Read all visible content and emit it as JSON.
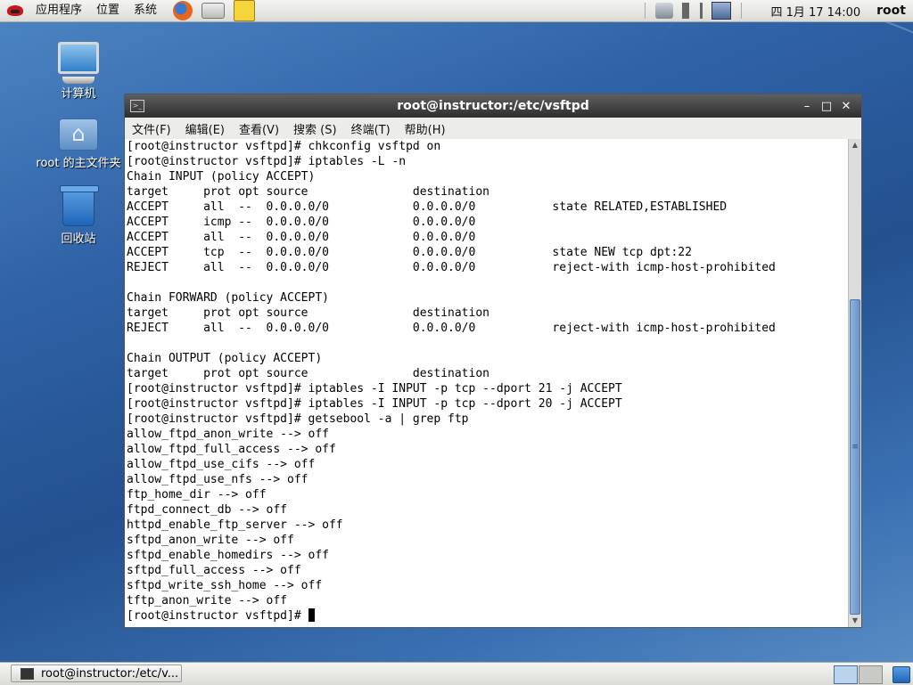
{
  "top_panel": {
    "menus": [
      "应用程序",
      "位置",
      "系统"
    ],
    "clock": "四 1月 17 14:00",
    "user": "root"
  },
  "desktop": {
    "icons": [
      {
        "label": "计算机",
        "icon": "computer-icon"
      },
      {
        "label": "root 的主文件夹",
        "icon": "home-folder-icon"
      },
      {
        "label": "回收站",
        "icon": "trash-icon"
      }
    ]
  },
  "terminal": {
    "title": "root@instructor:/etc/vsftpd",
    "menu": [
      "文件(F)",
      "编辑(E)",
      "查看(V)",
      "搜索 (S)",
      "终端(T)",
      "帮助(H)"
    ],
    "lines": [
      "[root@instructor vsftpd]# chkconfig vsftpd on",
      "[root@instructor vsftpd]# iptables -L -n",
      "Chain INPUT (policy ACCEPT)",
      "target     prot opt source               destination",
      "ACCEPT     all  --  0.0.0.0/0            0.0.0.0/0           state RELATED,ESTABLISHED",
      "ACCEPT     icmp --  0.0.0.0/0            0.0.0.0/0",
      "ACCEPT     all  --  0.0.0.0/0            0.0.0.0/0",
      "ACCEPT     tcp  --  0.0.0.0/0            0.0.0.0/0           state NEW tcp dpt:22",
      "REJECT     all  --  0.0.0.0/0            0.0.0.0/0           reject-with icmp-host-prohibited",
      "",
      "Chain FORWARD (policy ACCEPT)",
      "target     prot opt source               destination",
      "REJECT     all  --  0.0.0.0/0            0.0.0.0/0           reject-with icmp-host-prohibited",
      "",
      "Chain OUTPUT (policy ACCEPT)",
      "target     prot opt source               destination",
      "[root@instructor vsftpd]# iptables -I INPUT -p tcp --dport 21 -j ACCEPT",
      "[root@instructor vsftpd]# iptables -I INPUT -p tcp --dport 20 -j ACCEPT",
      "[root@instructor vsftpd]# getsebool -a | grep ftp",
      "allow_ftpd_anon_write --> off",
      "allow_ftpd_full_access --> off",
      "allow_ftpd_use_cifs --> off",
      "allow_ftpd_use_nfs --> off",
      "ftp_home_dir --> off",
      "ftpd_connect_db --> off",
      "httpd_enable_ftp_server --> off",
      "sftpd_anon_write --> off",
      "sftpd_enable_homedirs --> off",
      "sftpd_full_access --> off",
      "sftpd_write_ssh_home --> off",
      "tftp_anon_write --> off"
    ],
    "prompt": "[root@instructor vsftpd]# "
  },
  "taskbar": {
    "window_button": "root@instructor:/etc/v..."
  }
}
